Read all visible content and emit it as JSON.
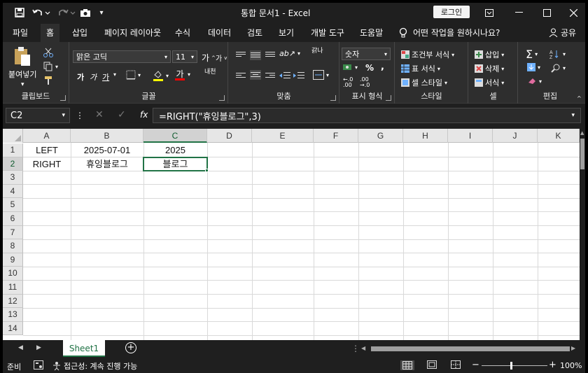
{
  "titlebar": {
    "title": "통합 문서1  -  Excel",
    "login_label": "로그인",
    "quick_access": [
      "save-icon",
      "undo-icon",
      "redo-icon",
      "camera-icon",
      "customize-icon"
    ]
  },
  "tabs": {
    "items": [
      "파일",
      "홈",
      "삽입",
      "페이지 레이아웃",
      "수식",
      "데이터",
      "검토",
      "보기",
      "개발 도구",
      "도움말"
    ],
    "active": "홈",
    "tell_me": "어떤 작업을 원하시나요?",
    "share": "공유"
  },
  "ribbon": {
    "clipboard": {
      "paste": "붙여넣기",
      "label": "클립보드"
    },
    "font": {
      "name": "맑은 고딕",
      "size": "11",
      "bold": "가",
      "italic": "가",
      "underline": "가",
      "font_color": "가",
      "phonetic": "내천",
      "grow": "가",
      "shrink": "가",
      "label": "글꼴"
    },
    "alignment": {
      "wrap": "갉나",
      "label": "맞춤"
    },
    "number": {
      "format": "숫자",
      "percent": "%",
      "comma": ",",
      "label": "표시 형식"
    },
    "styles": {
      "conditional": "조건부 서식",
      "table": "표 서식",
      "cell": "셀 스타일",
      "label": "스타일"
    },
    "cells": {
      "insert": "삽입",
      "delete": "삭제",
      "format": "서식",
      "label": "셀"
    },
    "editing": {
      "label": "편집"
    }
  },
  "formula_bar": {
    "name_box": "C2",
    "fx": "fx",
    "formula": "=RIGHT(\"휴잉블로그\",3)"
  },
  "sheet": {
    "columns": [
      "A",
      "B",
      "C",
      "D",
      "E",
      "F",
      "G",
      "H",
      "I",
      "J",
      "K"
    ],
    "rows": [
      "1",
      "2",
      "3",
      "4",
      "5",
      "6",
      "7",
      "8",
      "9",
      "10",
      "11",
      "12",
      "13",
      "14"
    ],
    "cells": {
      "A1": "LEFT",
      "B1": "2025-07-01",
      "C1": "2025",
      "A2": "RIGHT",
      "B2": "휴잉블로그",
      "C2": "블로그"
    },
    "selected_cell": "C2",
    "selected_column": "C",
    "selected_row": "2"
  },
  "sheet_tabs": {
    "active": "Sheet1",
    "add": "+"
  },
  "status_bar": {
    "ready": "준비",
    "accessibility": "접근성: 계속 진행 가능",
    "zoom": "100%"
  },
  "colors": {
    "accent": "#217346",
    "dark_bg": "#1f1f1f",
    "ribbon_bg": "#2e2e2e"
  }
}
